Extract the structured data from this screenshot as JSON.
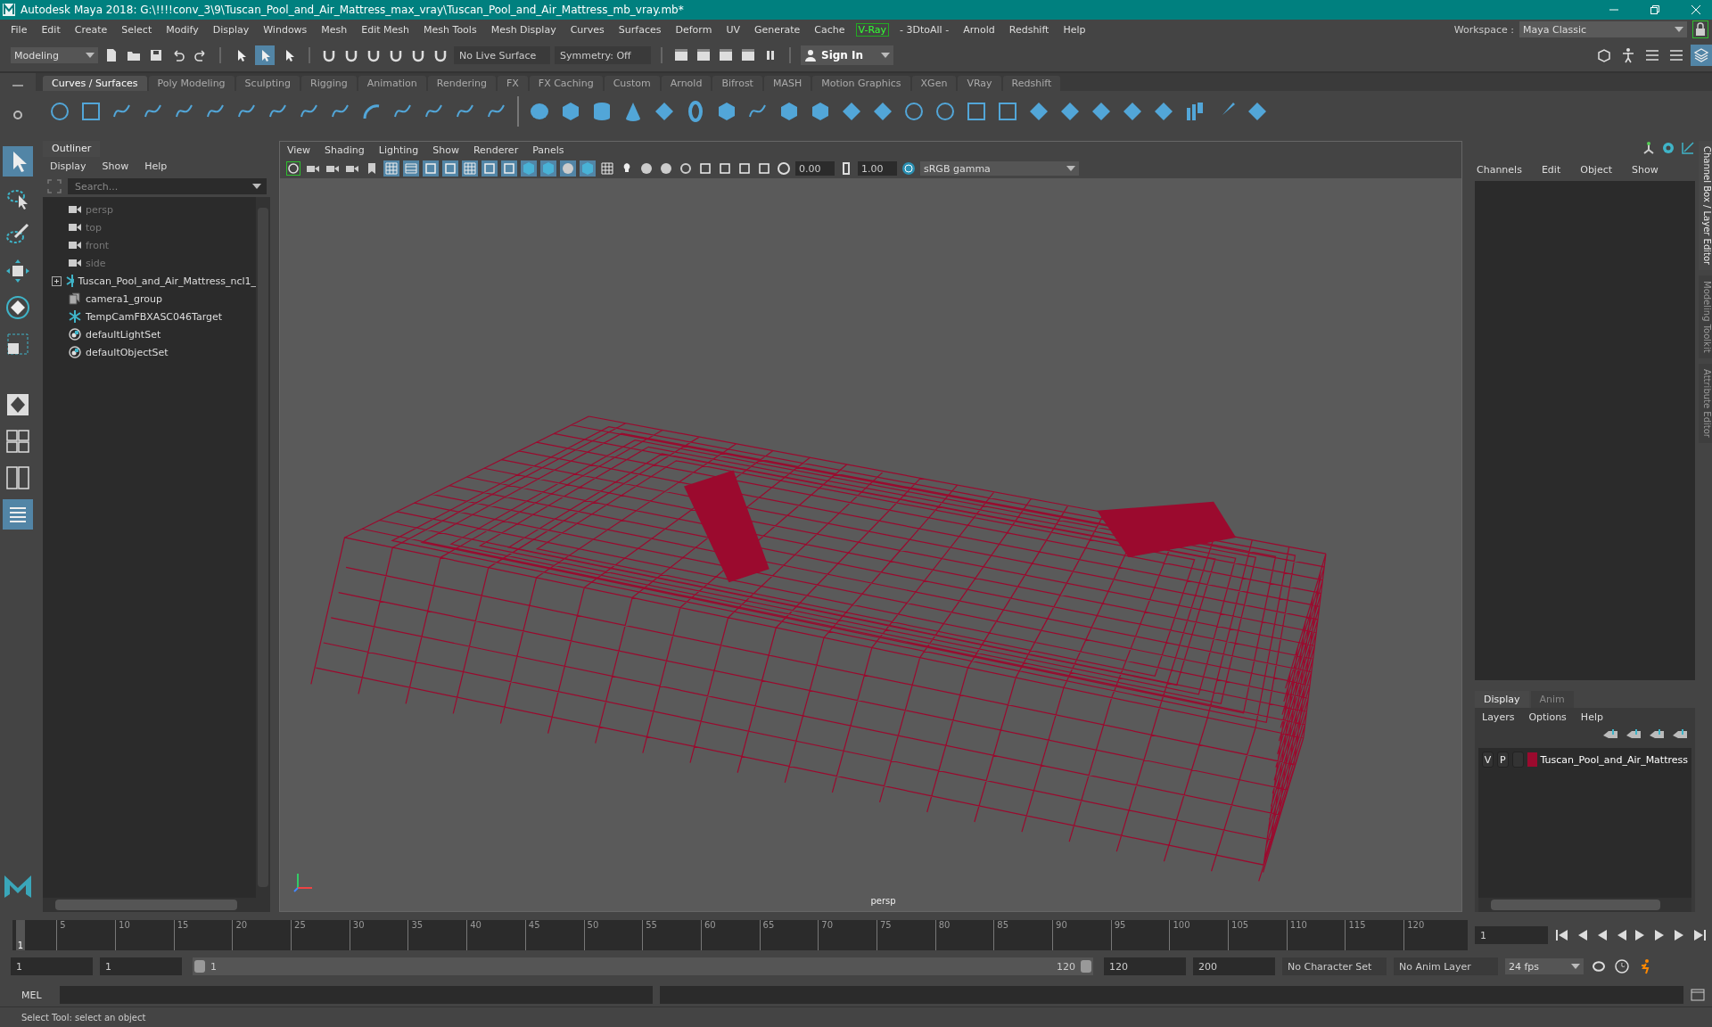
{
  "window": {
    "title": "Autodesk Maya 2018: G:\\!!!!conv_3\\9\\Tuscan_Pool_and_Air_Mattress_max_vray\\Tuscan_Pool_and_Air_Mattress_mb_vray.mb*"
  },
  "menu_bar": [
    {
      "label": "File",
      "kind": "menu"
    },
    {
      "label": "Edit",
      "kind": "menu"
    },
    {
      "label": "Create",
      "kind": "menu"
    },
    {
      "label": "Select",
      "kind": "menu"
    },
    {
      "label": "Modify",
      "kind": "menu"
    },
    {
      "label": "Display",
      "kind": "menu"
    },
    {
      "label": "Windows",
      "kind": "menu"
    },
    {
      "label": "Mesh",
      "kind": "menu"
    },
    {
      "label": "Edit Mesh",
      "kind": "menu"
    },
    {
      "label": "Mesh Tools",
      "kind": "menu"
    },
    {
      "label": "Mesh Display",
      "kind": "menu"
    },
    {
      "label": "Curves",
      "kind": "menu"
    },
    {
      "label": "Surfaces",
      "kind": "menu"
    },
    {
      "label": "Deform",
      "kind": "menu"
    },
    {
      "label": "UV",
      "kind": "menu"
    },
    {
      "label": "Generate",
      "kind": "menu"
    },
    {
      "label": "Cache",
      "kind": "menu"
    },
    {
      "label": "V-Ray",
      "kind": "plugin"
    },
    {
      "label": "- 3DtoAll -",
      "kind": "menu"
    },
    {
      "label": "Arnold",
      "kind": "menu"
    },
    {
      "label": "Redshift",
      "kind": "menu"
    },
    {
      "label": "Help",
      "kind": "menu"
    }
  ],
  "workspace": {
    "label": "Workspace :",
    "value": "Maya Classic"
  },
  "status_line": {
    "mode": "Modeling",
    "live_surface": "No Live Surface",
    "symmetry": "Symmetry: Off",
    "sign_in": "Sign In"
  },
  "shelf": {
    "tabs": [
      {
        "label": "Curves / Surfaces",
        "selected": true
      },
      {
        "label": "Poly Modeling",
        "selected": false
      },
      {
        "label": "Sculpting",
        "selected": false
      },
      {
        "label": "Rigging",
        "selected": false
      },
      {
        "label": "Animation",
        "selected": false
      },
      {
        "label": "Rendering",
        "selected": false
      },
      {
        "label": "FX",
        "selected": false
      },
      {
        "label": "FX Caching",
        "selected": false
      },
      {
        "label": "Custom",
        "selected": false
      },
      {
        "label": "Arnold",
        "selected": false
      },
      {
        "label": "Bifrost",
        "selected": false
      },
      {
        "label": "MASH",
        "selected": false
      },
      {
        "label": "Motion Graphics",
        "selected": false
      },
      {
        "label": "XGen",
        "selected": false
      },
      {
        "label": "VRay",
        "selected": false
      },
      {
        "label": "Redshift",
        "selected": false
      }
    ]
  },
  "outliner": {
    "title": "Outliner",
    "menu": [
      "Display",
      "Show",
      "Help"
    ],
    "search": {
      "placeholder": "Search..."
    },
    "items": [
      {
        "label": "persp",
        "kind": "camera",
        "dimmed": true,
        "expandable": false
      },
      {
        "label": "top",
        "kind": "camera",
        "dimmed": true,
        "expandable": false
      },
      {
        "label": "front",
        "kind": "camera",
        "dimmed": true,
        "expandable": false
      },
      {
        "label": "side",
        "kind": "camera",
        "dimmed": true,
        "expandable": false
      },
      {
        "label": "Tuscan_Pool_and_Air_Mattress_ncl1_",
        "kind": "transform",
        "dimmed": false,
        "expandable": true
      },
      {
        "label": "camera1_group",
        "kind": "group",
        "dimmed": false,
        "expandable": false
      },
      {
        "label": "TempCamFBXASC046Target",
        "kind": "transform",
        "dimmed": false,
        "expandable": false
      },
      {
        "label": "defaultLightSet",
        "kind": "set",
        "dimmed": false,
        "expandable": false
      },
      {
        "label": "defaultObjectSet",
        "kind": "set",
        "dimmed": false,
        "expandable": false
      }
    ]
  },
  "viewport": {
    "menu": [
      "View",
      "Shading",
      "Lighting",
      "Show",
      "Renderer",
      "Panels"
    ],
    "exposure": "0.00",
    "gamma": "1.00",
    "color_space": "sRGB gamma",
    "camera_label": "persp"
  },
  "channel_box": {
    "menu": [
      "Channels",
      "Edit",
      "Object",
      "Show"
    ]
  },
  "side_tabs": [
    {
      "label": "Channel Box / Layer Editor",
      "selected": true
    },
    {
      "label": "Modeling Toolkit",
      "selected": false
    },
    {
      "label": "Attribute Editor",
      "selected": false
    }
  ],
  "layer_editor": {
    "tabs": [
      {
        "label": "Display",
        "selected": true
      },
      {
        "label": "Anim",
        "selected": false
      }
    ],
    "menu": [
      "Layers",
      "Options",
      "Help"
    ],
    "layers": [
      {
        "visible": "V",
        "playback": "P",
        "color": "#9b0a2e",
        "name": "Tuscan_Pool_and_Air_Mattress"
      }
    ]
  },
  "timeline": {
    "current": "1",
    "level": 0,
    "ticks": [
      "5",
      "10",
      "15",
      "20",
      "25",
      "30",
      "35",
      "40",
      "45",
      "50",
      "55",
      "60",
      "65",
      "70",
      "75",
      "80",
      "85",
      "90",
      "95",
      "100",
      "105",
      "110",
      "115",
      "120"
    ],
    "current_frame": "1"
  },
  "range": {
    "level": 1,
    "start": "1",
    "playback_start": "1",
    "slider_start": "1",
    "slider_end": "120",
    "playback_end": "120",
    "end": "200",
    "character_set": "No Character Set",
    "anim_layer": "No Anim Layer",
    "fps": "24 fps"
  },
  "command_line": {
    "label": "MEL"
  },
  "help_line": "Select Tool: select an object"
}
